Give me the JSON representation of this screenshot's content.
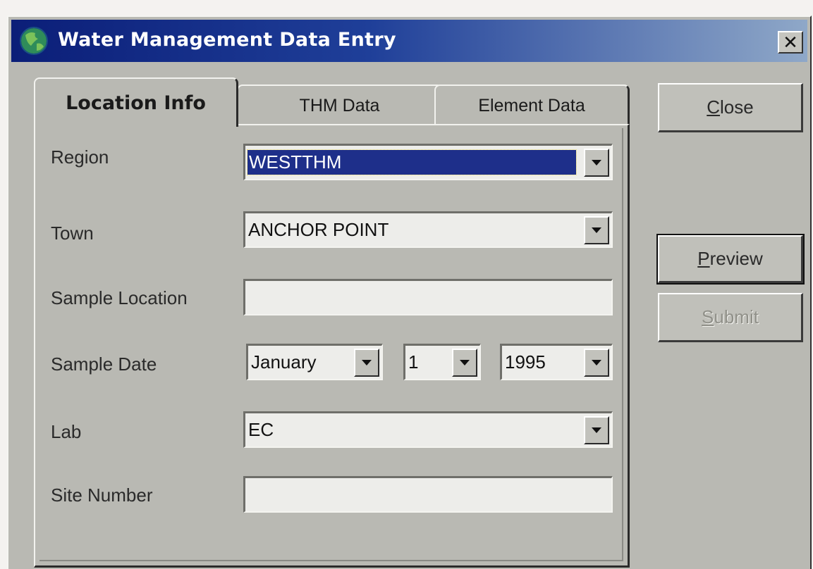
{
  "window": {
    "title": "Water Management Data Entry",
    "close_glyph": "✕"
  },
  "tabs": [
    {
      "label": "Location Info",
      "active": true
    },
    {
      "label": "THM Data",
      "active": false
    },
    {
      "label": "Element Data",
      "active": false
    }
  ],
  "form": {
    "region": {
      "label": "Region",
      "value": "WESTTHM"
    },
    "town": {
      "label": "Town",
      "value": "ANCHOR POINT"
    },
    "sample_location": {
      "label": "Sample Location",
      "value": ""
    },
    "sample_date": {
      "label": "Sample Date",
      "month": "January",
      "day": "1",
      "year": "1995"
    },
    "lab": {
      "label": "Lab",
      "value": "EC"
    },
    "site_number": {
      "label": "Site Number",
      "value": ""
    }
  },
  "buttons": {
    "close": {
      "mnemonic": "C",
      "rest": "lose"
    },
    "preview": {
      "mnemonic": "P",
      "rest": "review"
    },
    "submit": {
      "mnemonic": "S",
      "rest": "ubmit"
    }
  },
  "icons": {
    "app": "globe-icon",
    "dropdown": "chevron-down-icon"
  }
}
